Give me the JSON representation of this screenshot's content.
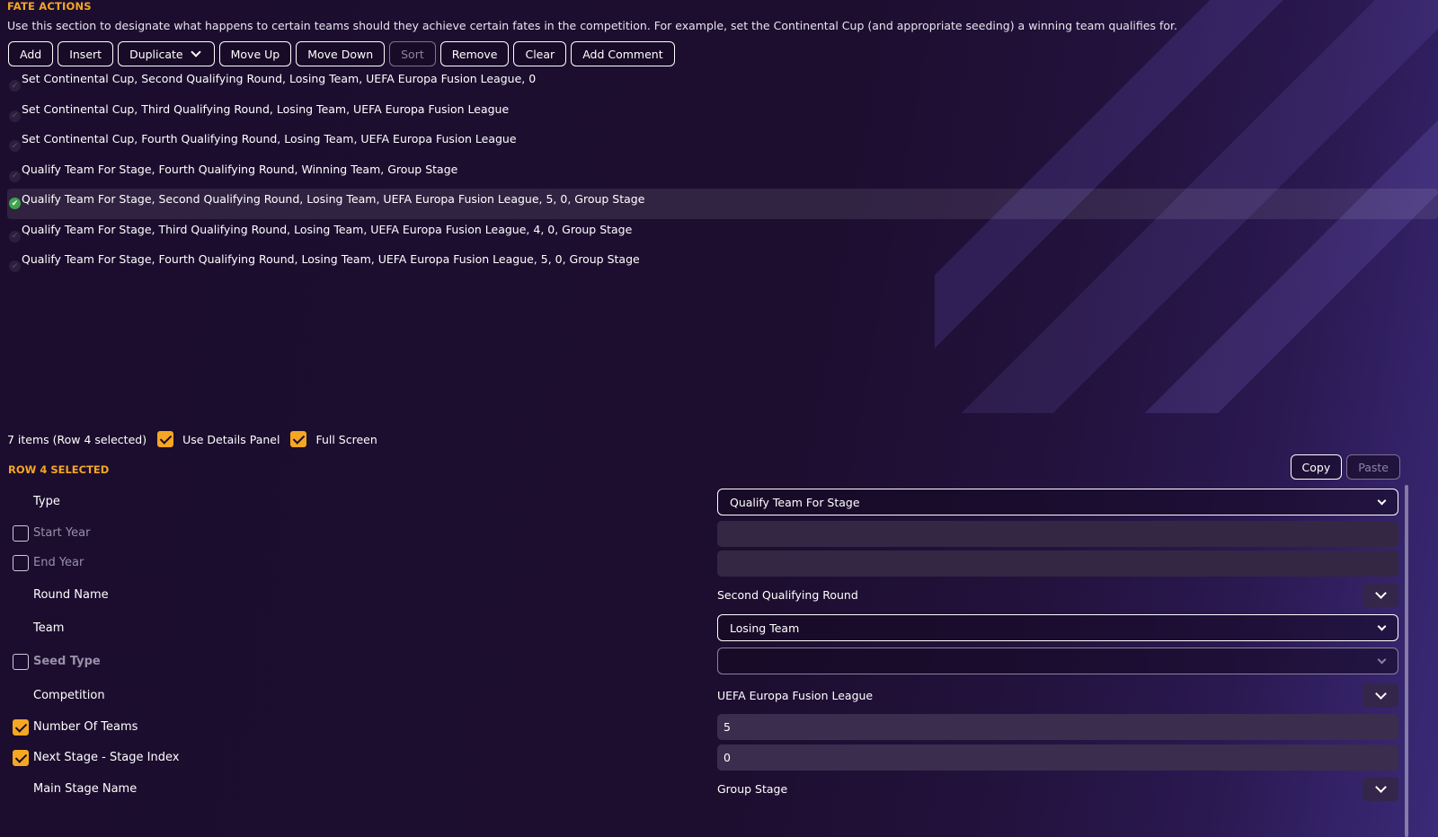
{
  "section": {
    "title": "FATE ACTIONS",
    "description": "Use this section to designate what happens to certain teams should they achieve certain fates in the competition. For example, set the Continental Cup (and appropriate seeding) a winning team qualifies for."
  },
  "toolbar": {
    "add": "Add",
    "insert": "Insert",
    "duplicate": "Duplicate",
    "move_up": "Move Up",
    "move_down": "Move Down",
    "sort": "Sort",
    "remove": "Remove",
    "clear": "Clear",
    "add_comment": "Add Comment"
  },
  "items": [
    "Set Continental Cup, Second Qualifying Round, Losing Team, UEFA Europa Fusion League, 0",
    "Set Continental Cup, Third Qualifying Round, Losing Team, UEFA Europa Fusion League",
    "Set Continental Cup, Fourth Qualifying Round, Losing Team, UEFA Europa Fusion League",
    "Qualify Team For Stage, Fourth Qualifying Round, Winning Team, Group Stage",
    "Qualify Team For Stage, Second Qualifying Round, Losing Team, UEFA Europa Fusion League, 5, 0, Group Stage",
    "Qualify Team For Stage, Third Qualifying Round, Losing Team, UEFA Europa Fusion League, 4, 0, Group Stage",
    "Qualify Team For Stage, Fourth Qualifying Round, Losing Team, UEFA Europa Fusion League, 5, 0, Group Stage"
  ],
  "selected_index": 4,
  "status": {
    "count_text": "7 items (Row 4 selected)",
    "use_details_panel": "Use Details Panel",
    "full_screen": "Full Screen"
  },
  "details": {
    "header": "ROW 4 SELECTED",
    "copy": "Copy",
    "paste": "Paste",
    "type_label": "Type",
    "type_value": "Qualify Team For Stage",
    "start_year_label": "Start Year",
    "start_year_value": "",
    "end_year_label": "End Year",
    "end_year_value": "",
    "round_name_label": "Round Name",
    "round_name_value": "Second Qualifying Round",
    "team_label": "Team",
    "team_value": "Losing Team",
    "seed_type_label": "Seed Type",
    "seed_type_value": "",
    "competition_label": "Competition",
    "competition_value": "UEFA Europa Fusion League",
    "num_teams_label": "Number Of Teams",
    "num_teams_value": "5",
    "next_stage_label": "Next Stage - Stage Index",
    "next_stage_value": "0",
    "main_stage_label": "Main Stage Name",
    "main_stage_value": "Group Stage"
  },
  "colors": {
    "accent": "#f5a623",
    "background": "#1c0d2e",
    "selected_tick": "#3fa34d"
  }
}
